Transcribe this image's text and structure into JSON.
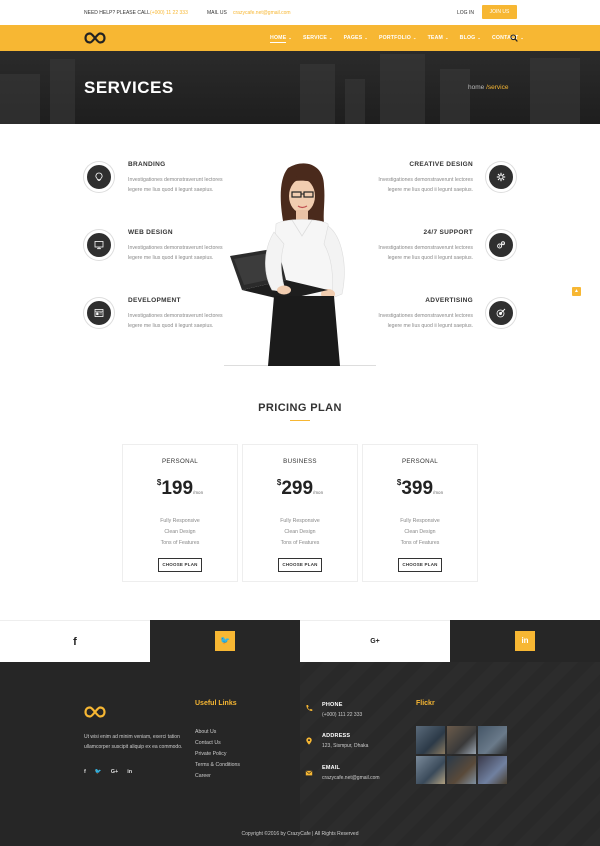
{
  "topbar": {
    "help_label": "NEED HELP? PLEASE CALL",
    "help_phone": "(+000) 11 22 333",
    "mail_label": "MAIL US",
    "mail_value": "crazycafe.net@gmail.com",
    "login": "LOG IN",
    "join": "JOIN US"
  },
  "nav": {
    "items": [
      {
        "label": "HOME",
        "chevron": "⌄"
      },
      {
        "label": "SERVICE",
        "chevron": "⌄"
      },
      {
        "label": "PAGES",
        "chevron": "⌄"
      },
      {
        "label": "PORTFOLIO",
        "chevron": "⌄"
      },
      {
        "label": "TEAM",
        "chevron": "⌄"
      },
      {
        "label": "BLOG",
        "chevron": "⌄"
      },
      {
        "label": "CONTACT",
        "chevron": "⌄"
      }
    ]
  },
  "hero": {
    "title": "SERVICES",
    "crumb_home": "home",
    "crumb_current": " /service"
  },
  "services": {
    "left": [
      {
        "title": "BRANDING",
        "icon": "bulb-icon",
        "text": "Investigationes demonstraverunt lectores legere me lius quod ii legunt saepius."
      },
      {
        "title": "WEB DESIGN",
        "icon": "monitor-icon",
        "text": "Investigationes demonstraverunt lectores legere me lius quod ii legunt saepius."
      },
      {
        "title": "DEVELOPMENT",
        "icon": "code-window-icon",
        "text": "Investigationes demonstraverunt lectores legere me lius quod ii legunt saepius."
      }
    ],
    "right": [
      {
        "title": "CREATIVE DESIGN",
        "icon": "settings-icon",
        "text": "Investigationes demonstraverunt lectores legere me lius quod ii legunt saepius."
      },
      {
        "title": "24/7 SUPPORT",
        "icon": "gears-icon",
        "text": "Investigationes demonstraverunt lectores legere me lius quod ii legunt saepius."
      },
      {
        "title": "ADVERTISING",
        "icon": "target-icon",
        "text": "Investigationes demonstraverunt lectores legere me lius quod ii legunt saepius."
      }
    ]
  },
  "scroll_top_icon": "chevron-up-icon",
  "pricing": {
    "title": "PRICING PLAN",
    "plans": [
      {
        "name": "PERSONAL",
        "currency": "$",
        "price": "199",
        "period": "/mon",
        "features": [
          "Fully Responsive",
          "Clean Design",
          "Tons of Features"
        ],
        "button": "CHOOSE PLAN"
      },
      {
        "name": "BUSINESS",
        "currency": "$",
        "price": "299",
        "period": "/mon",
        "features": [
          "Fully Responsive",
          "Clean Design",
          "Tons of Features"
        ],
        "button": "CHOOSE PLAN"
      },
      {
        "name": "PERSONAL",
        "currency": "$",
        "price": "399",
        "period": "/mon",
        "features": [
          "Fully Responsive",
          "Clean Design",
          "Tons of Features"
        ],
        "button": "CHOOSE PLAN"
      }
    ]
  },
  "social_bar": [
    {
      "icon": "facebook-icon",
      "glyph": "f"
    },
    {
      "icon": "twitter-icon",
      "glyph": "🐦"
    },
    {
      "icon": "google-plus-icon",
      "glyph": "G+"
    },
    {
      "icon": "linkedin-icon",
      "glyph": "in"
    }
  ],
  "footer": {
    "about": "Ut wisi enim ad minim veniam, exerci tation ullamcorper suscipit aliquip ex ea commodo.",
    "social": [
      "f",
      "🐦",
      "G+",
      "in"
    ],
    "useful_links_title": "Useful Links",
    "links": [
      "About Us",
      "Contact Us",
      "Private Policy",
      "Terms & Conditions",
      "Career"
    ],
    "contact": [
      {
        "label": "PHONE",
        "value": "(+000) 111 22 333",
        "icon": "phone-icon"
      },
      {
        "label": "ADDRESS",
        "value": "123, Sismpur, Dhaka",
        "icon": "location-icon"
      },
      {
        "label": "EMAIL",
        "value": "crazycafe.net@gmail.com",
        "icon": "mail-icon"
      }
    ],
    "flickr_title": "Flickr",
    "copyright": "Copyright ©2016 by CrazyCafe   |   All Rights Reserved"
  },
  "colors": {
    "accent": "#f7b733",
    "dark": "#262626"
  }
}
